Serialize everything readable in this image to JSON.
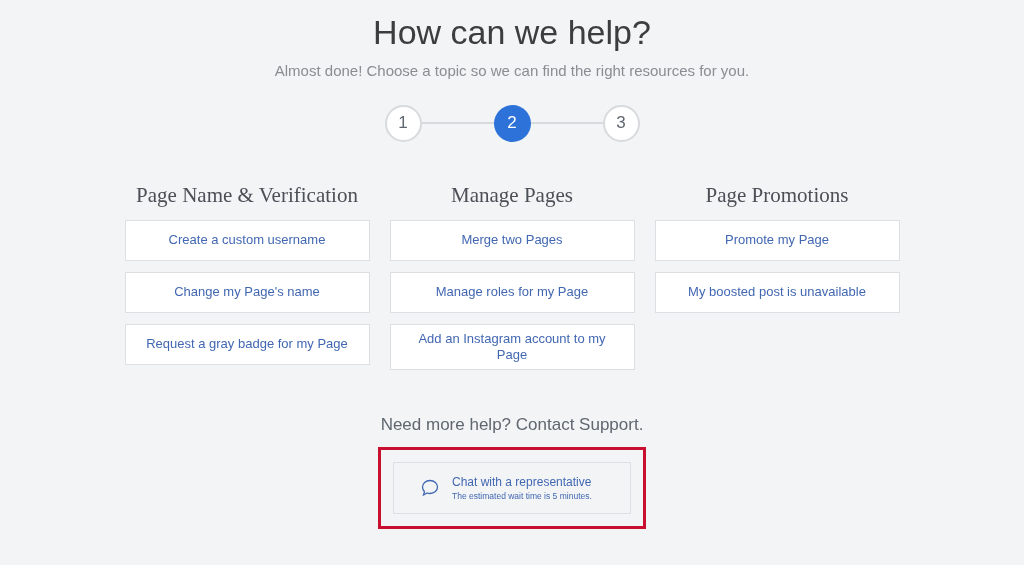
{
  "title": "How can we help?",
  "subtitle": "Almost done! Choose a topic so we can find the right resources for you.",
  "steps": [
    {
      "label": "1",
      "selected": false
    },
    {
      "label": "2",
      "selected": true
    },
    {
      "label": "3",
      "selected": false
    }
  ],
  "topics": [
    {
      "heading": "Page Name & Verification",
      "options": [
        "Create a custom username",
        "Change my Page's name",
        "Request a gray badge for my Page"
      ]
    },
    {
      "heading": "Manage Pages",
      "options": [
        "Merge two Pages",
        "Manage roles for my Page",
        "Add an Instagram account to my Page"
      ]
    },
    {
      "heading": "Page Promotions",
      "options": [
        "Promote my Page",
        "My boosted post is unavailable"
      ]
    }
  ],
  "support": {
    "heading": "Need more help? Contact Support.",
    "chat": {
      "label": "Chat with a representative",
      "note": "The estimated wait time is 5 minutes.",
      "highlighted": true
    }
  }
}
